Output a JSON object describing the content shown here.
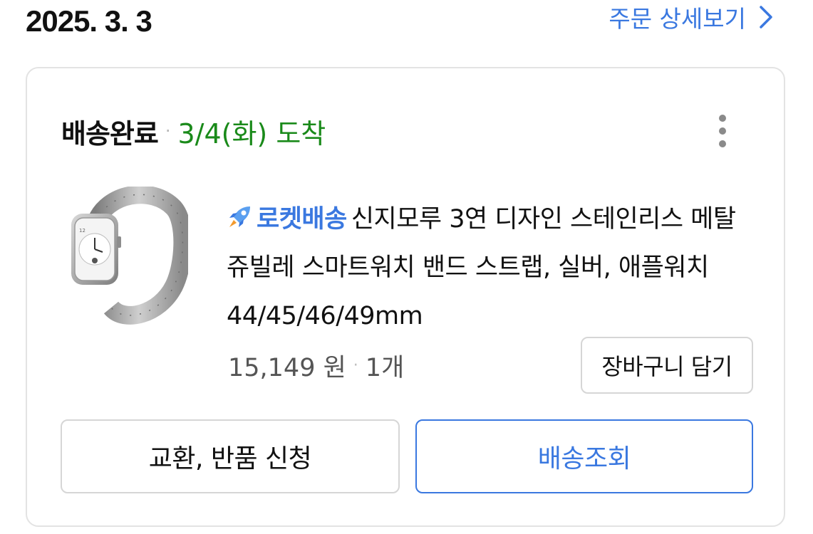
{
  "order": {
    "date": "2025. 3. 3",
    "detail_link_label": "주문 상세보기"
  },
  "shipment": {
    "status": "배송완료",
    "separator": "·",
    "arrival": "3/4(화) 도착"
  },
  "product": {
    "badge_label": "로켓배송",
    "title": "신지모루 3연 디자인 스테인리스 메탈 쥬빌레 스마트워치 밴드 스트랩, 실버, 애플워치 44/45/46/49mm",
    "price": "15,149 원",
    "separator": "·",
    "quantity": "1개",
    "image_icon": "smartwatch-product-image"
  },
  "actions": {
    "add_to_cart": "장바구니 담기",
    "exchange_return": "교환, 반품 신청",
    "track_delivery": "배송조회"
  },
  "colors": {
    "accent_blue": "#3a78e0",
    "arrival_green": "#1a8a1a",
    "border_gray": "#d6d6d6",
    "card_border": "#e3e3e3"
  }
}
